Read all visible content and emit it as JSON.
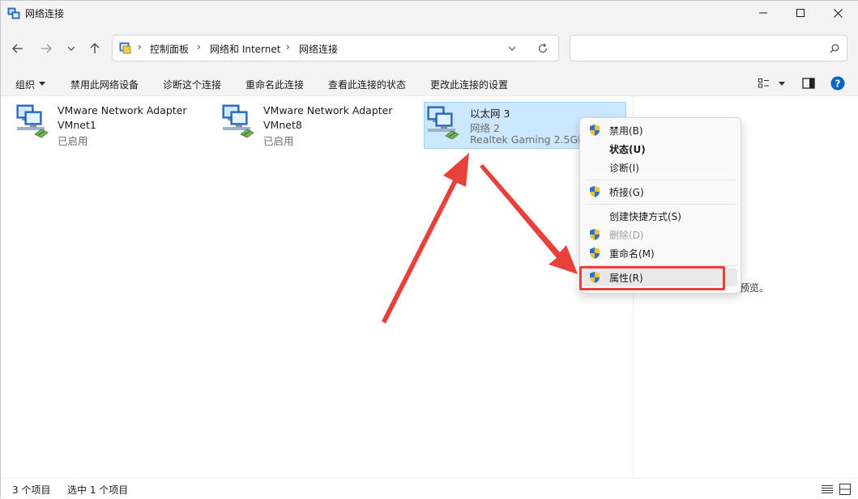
{
  "window": {
    "title": "网络连接",
    "controls": {
      "minimize": "—",
      "maximize": "☐",
      "close": "✕"
    }
  },
  "address": {
    "breadcrumbs": [
      "控制面板",
      "网络和 Internet",
      "网络连接"
    ],
    "search_placeholder": ""
  },
  "commands": {
    "organize": "组织",
    "disable": "禁用此网络设备",
    "diagnose": "诊断这个连接",
    "rename": "重命名此连接",
    "status": "查看此连接的状态",
    "settings": "更改此连接的设置"
  },
  "items": [
    {
      "name": "VMware Network Adapter",
      "sub": "VMnet1",
      "status": "已启用"
    },
    {
      "name": "VMware Network Adapter",
      "sub": "VMnet8",
      "status": "已启用"
    },
    {
      "name": "以太网 3",
      "sub": "网络 2",
      "status": "Realtek Gaming 2.5GbE"
    }
  ],
  "context_menu": {
    "disable": "禁用(B)",
    "status": "状态(U)",
    "diagnose": "诊断(I)",
    "bridge": "桥接(G)",
    "shortcut": "创建快捷方式(S)",
    "delete": "删除(D)",
    "rename": "重命名(M)",
    "properties": "属性(R)"
  },
  "preview_text": "预览。",
  "statusbar": {
    "count": "3 个项目",
    "selected": "选中 1 个项目"
  },
  "colors": {
    "accent_blue": "#0067c0",
    "selection": "#cce8ff",
    "annotation_red": "#e8403a"
  }
}
